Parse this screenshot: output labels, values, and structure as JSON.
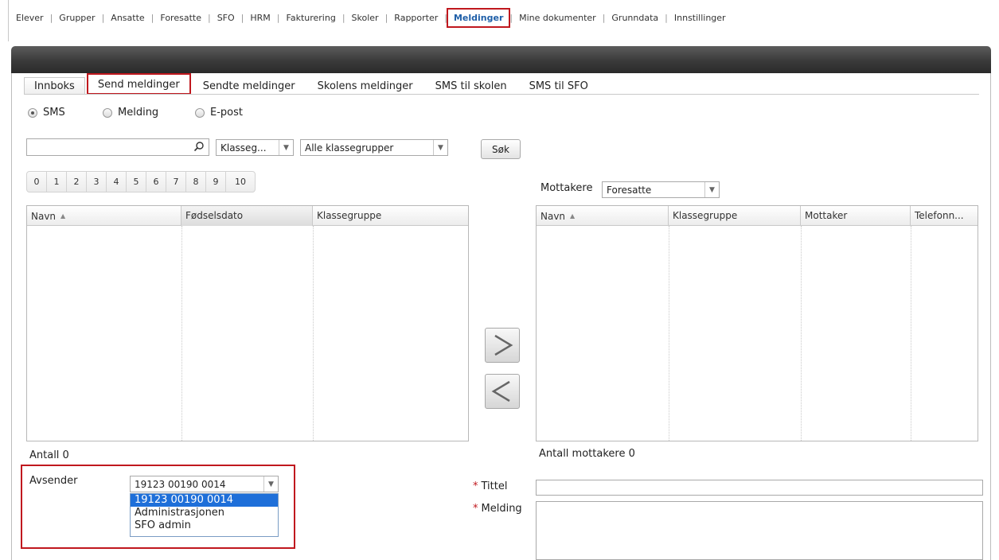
{
  "nav": {
    "items": [
      "Elever",
      "Grupper",
      "Ansatte",
      "Foresatte",
      "SFO",
      "HRM",
      "Fakturering",
      "Skoler",
      "Rapporter",
      "Meldinger",
      "Mine dokumenter",
      "Grunndata",
      "Innstillinger"
    ],
    "active": "Meldinger"
  },
  "tabs": {
    "inbox": "Innboks",
    "send": "Send meldinger",
    "sent": "Sendte meldinger",
    "school": "Skolens meldinger",
    "sms_school": "SMS til skolen",
    "sms_sfo": "SMS til SFO"
  },
  "message_type": {
    "sms": "SMS",
    "message": "Melding",
    "email": "E-post",
    "selected": "SMS"
  },
  "search": {
    "value": "",
    "group_type": "Klasseg...",
    "group": "Alle klassegrupper",
    "button": "Søk"
  },
  "pager": [
    "0",
    "1",
    "2",
    "3",
    "4",
    "5",
    "6",
    "7",
    "8",
    "9",
    "10"
  ],
  "left_grid": {
    "columns": [
      "Navn",
      "Fødselsdato",
      "Klassegruppe"
    ],
    "count_label": "Antall 0"
  },
  "right_grid": {
    "recipients_label": "Mottakere",
    "recipients_value": "Foresatte",
    "columns": [
      "Navn",
      "Klassegruppe",
      "Mottaker",
      "Telefonn..."
    ],
    "count_label": "Antall mottakere 0"
  },
  "sender": {
    "label": "Avsender",
    "value": "19123 00190 0014",
    "options": [
      "19123 00190 0014",
      "Administrasjonen",
      "SFO admin"
    ]
  },
  "form": {
    "title_label": "Tittel",
    "title_value": "",
    "message_label": "Melding",
    "message_value": "",
    "required_mark": "*"
  },
  "colors": {
    "highlight_border": "#c0181e",
    "nav_active_text": "#1f5fa8",
    "banner": "#3a3a3a",
    "dropdown_selected": "#1e6fd9"
  }
}
